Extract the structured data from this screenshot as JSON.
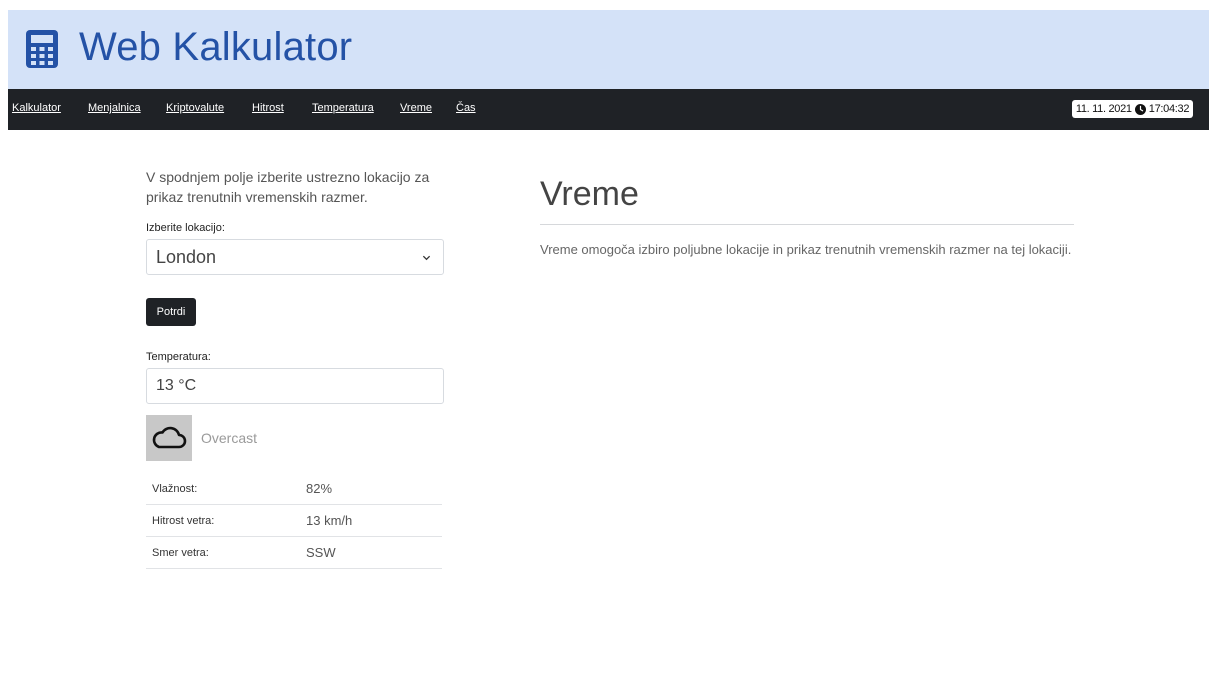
{
  "header": {
    "title": "Web Kalkulator",
    "icon": "calculator-icon"
  },
  "nav": {
    "items": [
      {
        "label": "Kalkulator"
      },
      {
        "label": "Menjalnica"
      },
      {
        "label": "Kriptovalute"
      },
      {
        "label": "Hitrost"
      },
      {
        "label": "Temperatura"
      },
      {
        "label": "Vreme"
      },
      {
        "label": "Čas"
      }
    ],
    "date": "11. 11. 2021",
    "time": "17:04:32"
  },
  "form": {
    "intro": "V spodnjem polje izberite ustrezno lokacijo za prikaz trenutnih vremenskih razmer.",
    "location_label": "Izberite lokacijo:",
    "location_value": "London",
    "submit_label": "Potrdi",
    "temperature_label": "Temperatura:",
    "temperature_value": "13 °C"
  },
  "weather": {
    "icon": "cloud-icon",
    "condition": "Overcast",
    "details": [
      {
        "key": "Vlažnost:",
        "value": "82%"
      },
      {
        "key": "Hitrost vetra:",
        "value": "13 km/h"
      },
      {
        "key": "Smer vetra:",
        "value": "SSW"
      }
    ]
  },
  "main": {
    "title": "Vreme",
    "description": "Vreme omogoča izbiro poljubne lokacije in prikaz trenutnih vremenskih razmer na tej lokaciji."
  },
  "colors": {
    "header_bg": "#d4e2f8",
    "title": "#2452a6",
    "navbar": "#1f2226"
  }
}
